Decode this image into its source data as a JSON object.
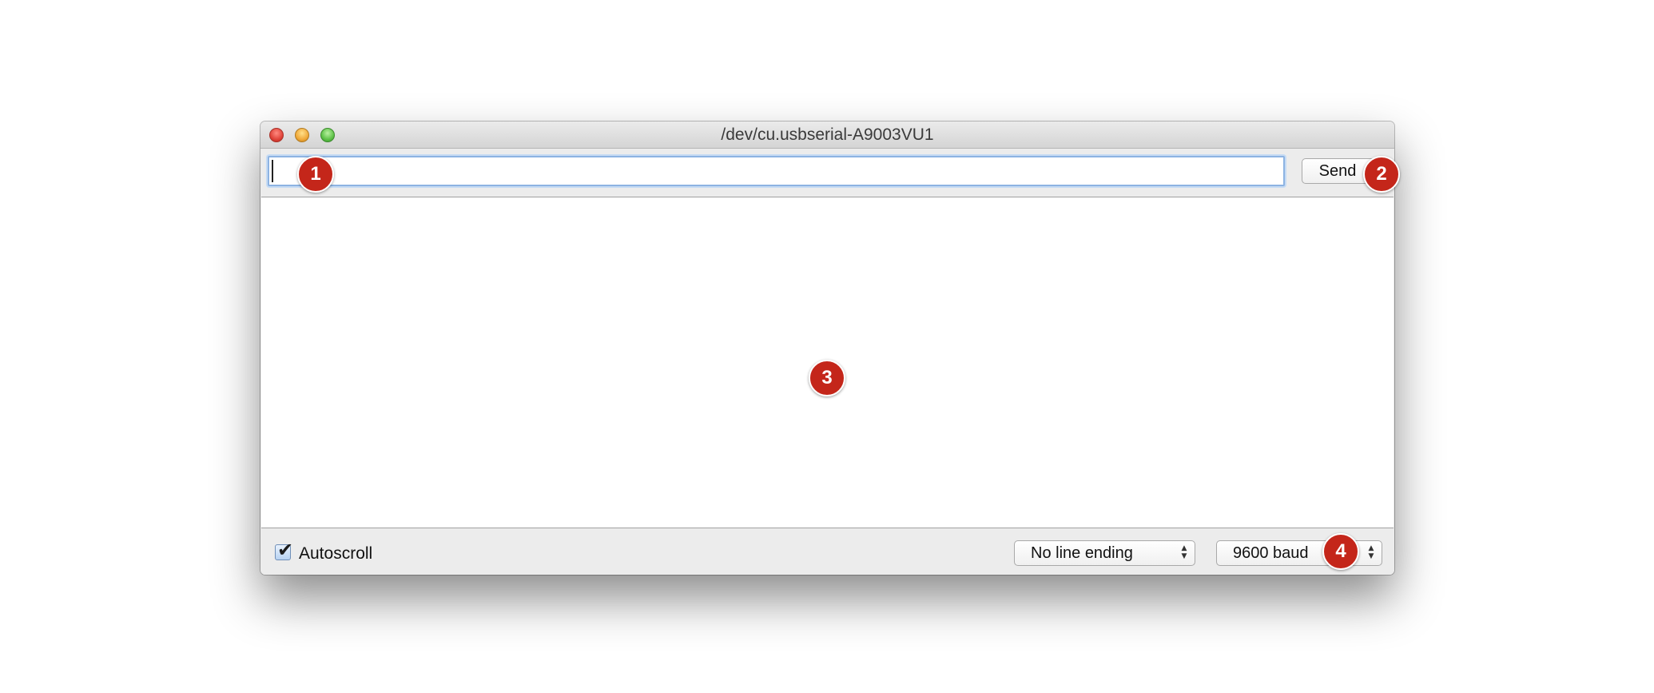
{
  "window": {
    "title": "/dev/cu.usbserial-A9003VU1"
  },
  "input_row": {
    "input_value": "",
    "send_label": "Send"
  },
  "output": {
    "text": ""
  },
  "bottom_bar": {
    "autoscroll_label": "Autoscroll",
    "autoscroll_checked": true,
    "line_ending_selected": "No line ending",
    "baud_selected": "9600 baud"
  },
  "annotations": {
    "m1": "1",
    "m2": "2",
    "m3": "3",
    "m4": "4"
  },
  "colors": {
    "marker": "#c4261a",
    "input_focus": "#8db3e2"
  },
  "icons": {
    "close": "close-icon",
    "minimize": "minimize-icon",
    "zoom": "zoom-icon",
    "checkmark": "checkmark-icon",
    "select_arrows": "up-down-arrows-icon"
  }
}
